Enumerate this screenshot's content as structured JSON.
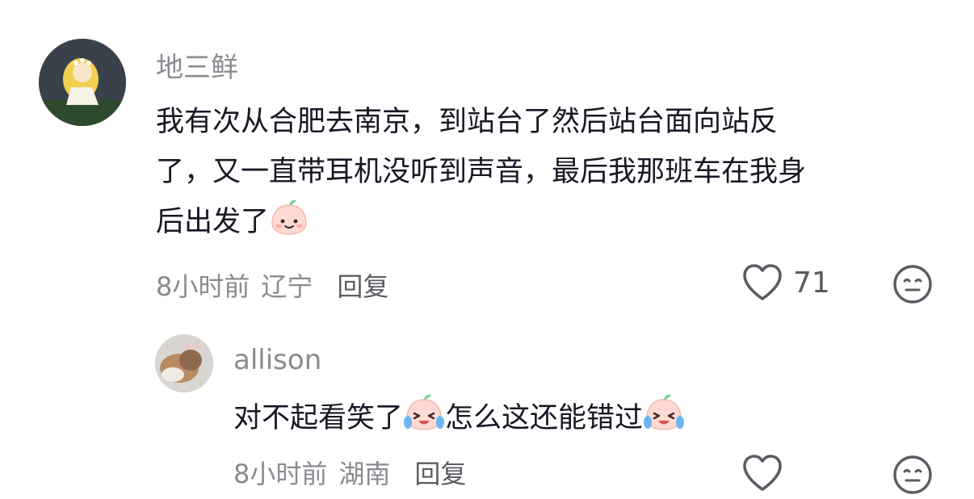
{
  "comments": [
    {
      "username": "地三鲜",
      "text_lines": [
        "我有次从合肥去南京，到站台了然后站台面向站反",
        "了，又一直带耳机没听到声音，最后我那班车在我身",
        "后出发了"
      ],
      "emoji": "smiling-peach-emoji",
      "time": "8小时前",
      "location": "辽宁",
      "reply_label": "回复",
      "like_count": "71",
      "like_icon": "heart-icon",
      "dislike_icon": "meh-face-icon"
    },
    {
      "username": "allison",
      "text_parts": [
        "对不起看笑了",
        "怎么这还能错过"
      ],
      "emoji": "laughing-crying-peach-emoji",
      "time": "8小时前",
      "location": "湖南",
      "reply_label": "回复",
      "like_icon": "heart-icon",
      "dislike_icon": "meh-face-icon"
    }
  ],
  "colors": {
    "text": "#161823",
    "muted": "#8a8b91",
    "peach": "#ffd9d2"
  }
}
